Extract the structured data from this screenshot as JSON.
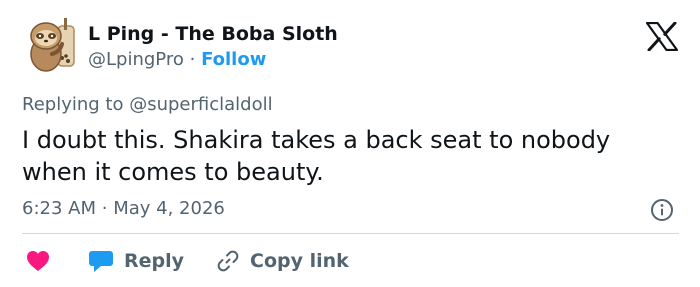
{
  "author": {
    "name": "L Ping - The Boba Sloth",
    "handle": "@LpingPro",
    "separator": "·",
    "follow_label": "Follow"
  },
  "reply_context": {
    "prefix": "Replying to",
    "handle": "@superficlaldoll"
  },
  "tweet": {
    "text": "I doubt this. Shakira takes a back seat to nobody when it comes to beauty."
  },
  "meta": {
    "time": "6:23 AM",
    "separator": "·",
    "date": "May 4, 2026"
  },
  "actions": {
    "reply_label": "Reply",
    "copy_link_label": "Copy link"
  },
  "colors": {
    "accent": "#1d9bf0",
    "like": "#f91880",
    "secondary_text": "#536471",
    "primary_text": "#0f1419",
    "divider": "#cfd9de"
  },
  "icons": [
    "avatar-sloth",
    "x-logo-icon",
    "info-icon",
    "heart-icon",
    "reply-bubble-icon",
    "link-icon"
  ]
}
